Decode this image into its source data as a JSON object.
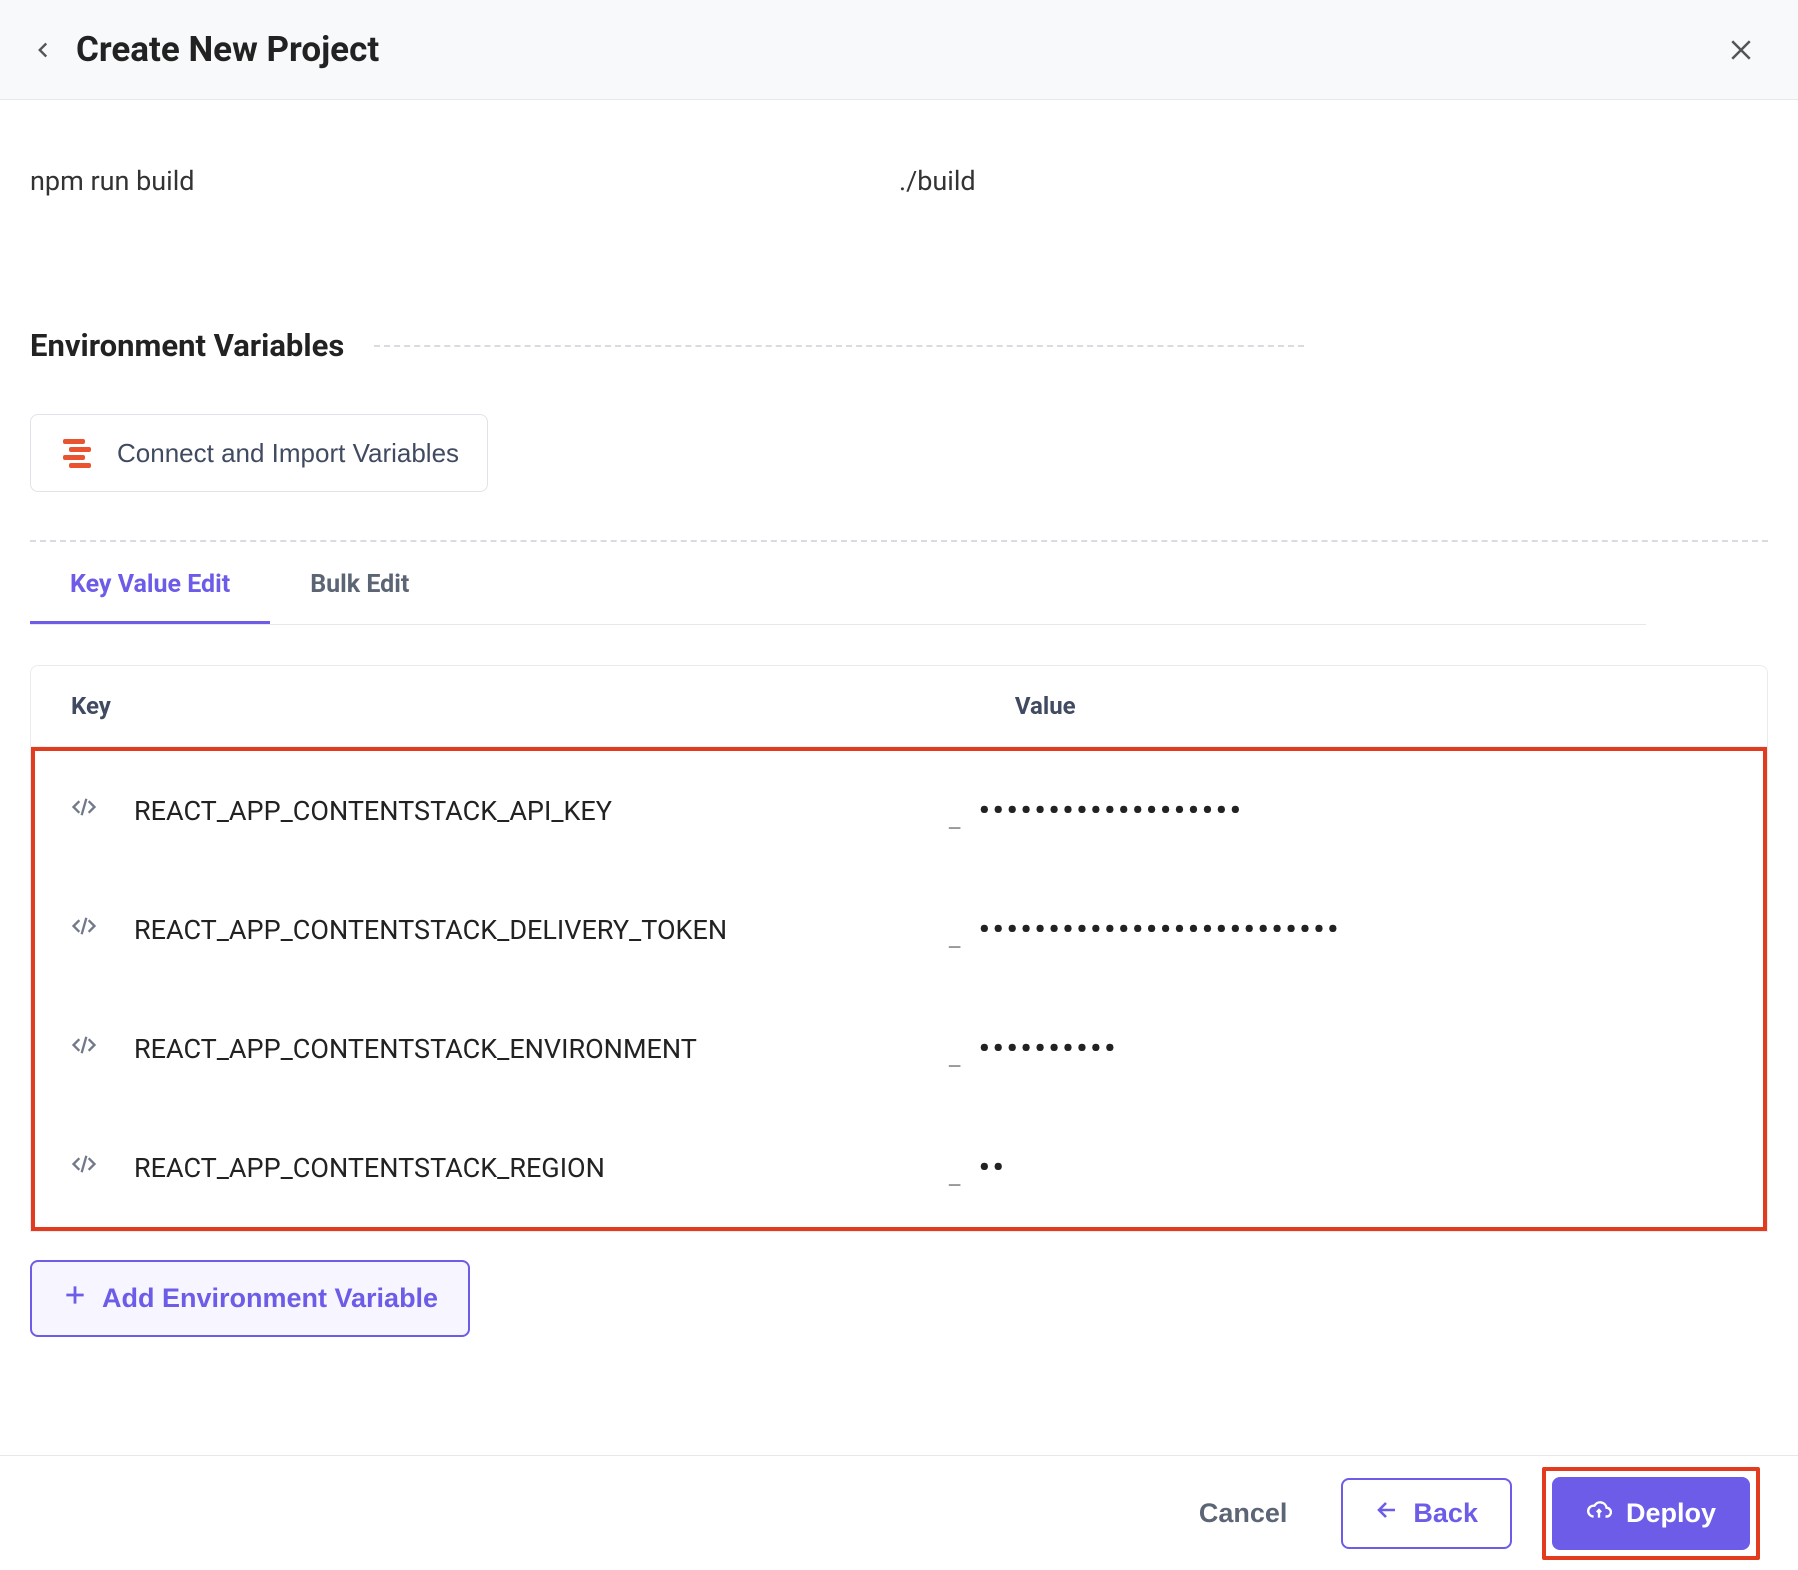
{
  "header": {
    "title": "Create New Project"
  },
  "build": {
    "build_command_value": "npm run build",
    "output_dir_value": "./build"
  },
  "env_section": {
    "title": "Environment Variables",
    "connect_label": "Connect and Import Variables",
    "tabs": {
      "key_value": "Key Value Edit",
      "bulk": "Bulk Edit"
    },
    "table": {
      "header_key": "Key",
      "header_value": "Value"
    },
    "rows": [
      {
        "key": "REACT_APP_CONTENTSTACK_API_KEY",
        "value": "•••••••••••••••••••"
      },
      {
        "key": "REACT_APP_CONTENTSTACK_DELIVERY_TOKEN",
        "value": "••••••••••••••••••••••••••"
      },
      {
        "key": "REACT_APP_CONTENTSTACK_ENVIRONMENT",
        "value": "••••••••••"
      },
      {
        "key": "REACT_APP_CONTENTSTACK_REGION",
        "value": "••"
      }
    ],
    "add_label": "Add Environment Variable"
  },
  "footer": {
    "cancel": "Cancel",
    "back": "Back",
    "deploy": "Deploy"
  }
}
